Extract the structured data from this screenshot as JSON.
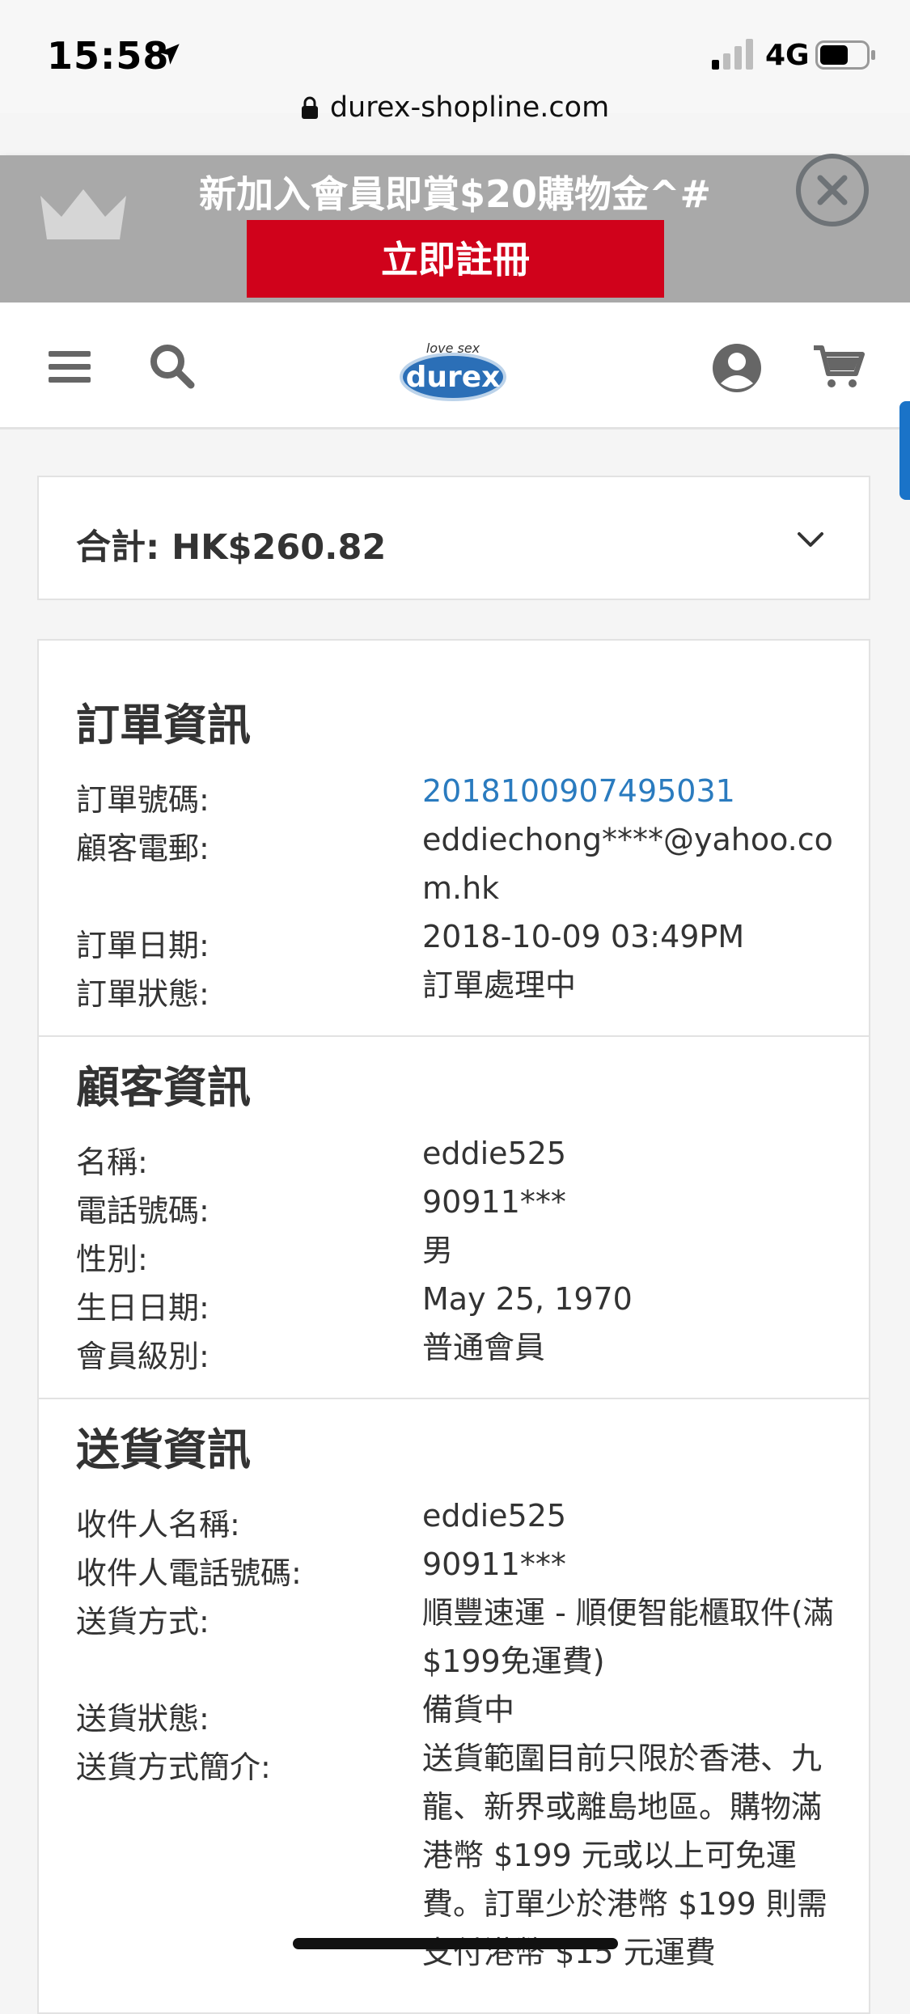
{
  "status_bar": {
    "time": "15:58",
    "network": "4G"
  },
  "browser": {
    "url": "durex-shopline.com"
  },
  "promo": {
    "text": "新加入會員即賞$20購物金^#",
    "button": "立即註冊"
  },
  "header": {
    "logo_tagline": "love sex",
    "logo_text": "durex"
  },
  "summary": {
    "label": "合計: HK$260.82"
  },
  "order_info": {
    "title": "訂單資訊",
    "rows": [
      {
        "label": "訂單號碼:",
        "value": "2018100907495031"
      },
      {
        "label": "顧客電郵:",
        "value": "eddiechong****@yahoo.com.hk"
      },
      {
        "label": "訂單日期:",
        "value": "2018-10-09 03:49PM"
      },
      {
        "label": "訂單狀態:",
        "value": "訂單處理中"
      }
    ]
  },
  "customer_info": {
    "title": "顧客資訊",
    "rows": [
      {
        "label": "名稱:",
        "value": "eddie525"
      },
      {
        "label": "電話號碼:",
        "value": "90911***"
      },
      {
        "label": "性別:",
        "value": "男"
      },
      {
        "label": "生日日期:",
        "value": "May 25, 1970"
      },
      {
        "label": "會員級別:",
        "value": "普通會員"
      }
    ]
  },
  "delivery_info": {
    "title": "送貨資訊",
    "rows": [
      {
        "label": "收件人名稱:",
        "value": "eddie525"
      },
      {
        "label": "收件人電話號碼:",
        "value": "90911***"
      },
      {
        "label": "送貨方式:",
        "value": "順豐速運 - 順便智能櫃取件(滿$199免運費)"
      },
      {
        "label": "送貨狀態:",
        "value": "備貨中"
      },
      {
        "label": "送貨方式簡介:",
        "value": "送貨範圍目前只限於香港、九龍、新界或離島地區。購物滿港幣 $199 元或以上可免運費。訂單少於港幣 $199 則需支付港幣 $15 元運費"
      }
    ]
  },
  "colors": {
    "promo_bg": "#a9a9a9",
    "signup_red": "#d0021b",
    "link_blue": "#2a7bbf",
    "side_tab": "#1a73c8"
  }
}
